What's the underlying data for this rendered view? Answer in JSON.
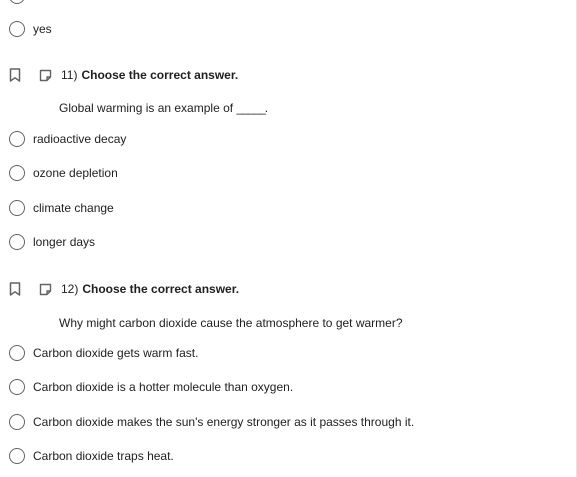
{
  "questions": [
    {
      "options": [
        "yes"
      ]
    },
    {
      "number": "11)",
      "instruction": "Choose the correct answer.",
      "prompt": "Global warming is an example of",
      "prompt_blank": "_____.",
      "options": [
        "radioactive decay",
        "ozone depletion",
        "climate change",
        "longer days"
      ]
    },
    {
      "number": "12)",
      "instruction": "Choose the correct answer.",
      "prompt": "Why might carbon dioxide cause the atmosphere to get warmer?",
      "options": [
        "Carbon dioxide gets warm fast.",
        "Carbon dioxide is a hotter molecule than oxygen.",
        "Carbon dioxide makes the sun's energy stronger as it passes through it.",
        "Carbon dioxide traps heat."
      ]
    }
  ],
  "icons": {
    "bookmark": "bookmark-icon",
    "flag": "flag-icon"
  },
  "colors": {
    "radio_border": "#5f6368",
    "selected_accent": "#1a73e8",
    "text": "#202124"
  }
}
